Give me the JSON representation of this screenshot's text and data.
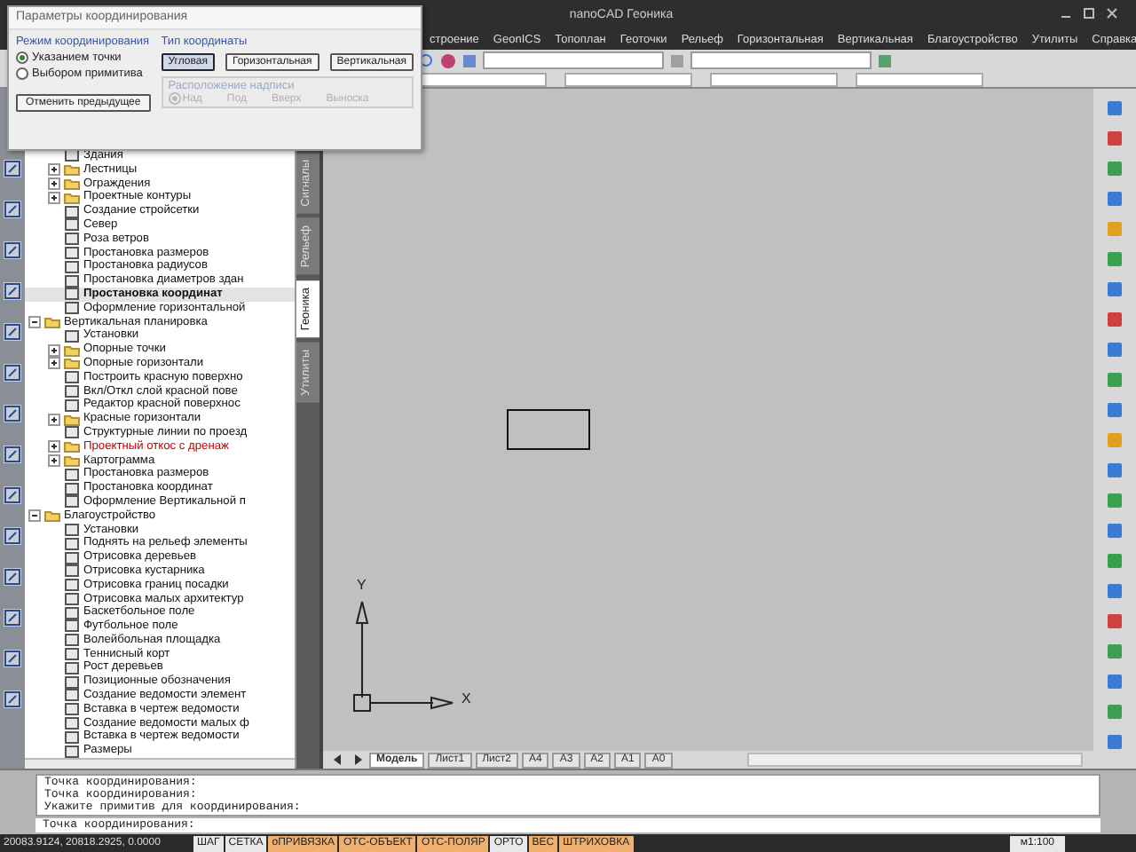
{
  "window": {
    "title": "nanoCAD Геоника"
  },
  "menu": [
    "строение",
    "GeonICS",
    "Топоплан",
    "Геоточки",
    "Рельеф",
    "Горизонтальная",
    "Вертикальная",
    "Благоустройство",
    "Утилиты",
    "Справка"
  ],
  "dialog": {
    "title": "Параметры координирования",
    "mode_group": {
      "title": "Режим координирования",
      "options": [
        {
          "label": "Указанием точки",
          "selected": true
        },
        {
          "label": "Выбором примитива",
          "selected": false
        }
      ]
    },
    "undo_button": "Отменить предыдущее",
    "type_group": {
      "title": "Тип координаты",
      "buttons": [
        {
          "label": "Угловая",
          "selected": true
        },
        {
          "label": "Горизонтальная",
          "selected": false
        },
        {
          "label": "Вертикальная",
          "selected": false
        }
      ]
    },
    "label_group": {
      "title": "Расположение надписи",
      "disabled": true,
      "options": [
        {
          "label": "Над",
          "selected": true
        },
        {
          "label": "Под",
          "selected": false
        },
        {
          "label": "Вверх",
          "selected": false
        },
        {
          "label": "Выноска",
          "selected": false
        }
      ]
    }
  },
  "tree": {
    "continued_items": [
      {
        "label": "Здания",
        "kind": "command"
      },
      {
        "label": "Лестницы",
        "kind": "folder",
        "expanded": false
      },
      {
        "label": "Ограждения",
        "kind": "folder",
        "expanded": false
      },
      {
        "label": "Проектные контуры",
        "kind": "folder",
        "expanded": false
      },
      {
        "label": "Создание стройсетки",
        "kind": "command"
      },
      {
        "label": "Север",
        "kind": "command"
      },
      {
        "label": "Роза ветров",
        "kind": "command"
      },
      {
        "label": "Простановка размеров",
        "kind": "command"
      },
      {
        "label": "Простановка радиусов",
        "kind": "command"
      },
      {
        "label": "Простановка диаметров здан",
        "kind": "command"
      },
      {
        "label": "Простановка координат",
        "kind": "command",
        "selected": true
      },
      {
        "label": "Оформление горизонтальной",
        "kind": "command"
      }
    ],
    "groups": [
      {
        "label": "Вертикальная планировка",
        "kind": "folder",
        "expanded": true,
        "children": [
          {
            "label": "Установки",
            "kind": "command"
          },
          {
            "label": "Опорные точки",
            "kind": "folder",
            "expanded": false
          },
          {
            "label": "Опорные горизонтали",
            "kind": "folder",
            "expanded": false
          },
          {
            "label": "Построить красную поверхно",
            "kind": "command"
          },
          {
            "label": "Вкл/Откл слой красной пове",
            "kind": "command"
          },
          {
            "label": "Редактор красной поверхнос",
            "kind": "command"
          },
          {
            "label": "Красные горизонтали",
            "kind": "folder",
            "expanded": false
          },
          {
            "label": "Структурные линии по проезд",
            "kind": "command"
          },
          {
            "label": "Проектный откос с дренаж",
            "kind": "folder",
            "expanded": false,
            "color": "#cc0000"
          },
          {
            "label": "Картограмма",
            "kind": "folder",
            "expanded": false
          },
          {
            "label": "Простановка размеров",
            "kind": "command"
          },
          {
            "label": "Простановка координат",
            "kind": "command"
          },
          {
            "label": "Оформление Вертикальной п",
            "kind": "command"
          }
        ]
      },
      {
        "label": "Благоустройство",
        "kind": "folder",
        "expanded": true,
        "children": [
          {
            "label": "Установки",
            "kind": "command"
          },
          {
            "label": "Поднять на рельеф элементы",
            "kind": "command"
          },
          {
            "label": "Отрисовка деревьев",
            "kind": "command"
          },
          {
            "label": "Отрисовка кустарника",
            "kind": "command"
          },
          {
            "label": "Отрисовка границ посадки",
            "kind": "command"
          },
          {
            "label": "Отрисовка малых архитектур",
            "kind": "command"
          },
          {
            "label": "Баскетбольное поле",
            "kind": "command"
          },
          {
            "label": "Футбольное поле",
            "kind": "command"
          },
          {
            "label": "Волейбольная площадка",
            "kind": "command"
          },
          {
            "label": "Теннисный корт",
            "kind": "command"
          },
          {
            "label": "Рост деревьев",
            "kind": "command"
          },
          {
            "label": "Позиционные обозначения",
            "kind": "command"
          },
          {
            "label": "Создание ведомости элемент",
            "kind": "command"
          },
          {
            "label": "Вставка в чертеж ведомости",
            "kind": "command"
          },
          {
            "label": "Создание ведомости малых ф",
            "kind": "command"
          },
          {
            "label": "Вставка в чертеж ведомости",
            "kind": "command"
          },
          {
            "label": "Размеры",
            "kind": "command"
          }
        ]
      }
    ]
  },
  "side_tabs": [
    {
      "label": "Сигналы",
      "selected": false
    },
    {
      "label": "Рельеф",
      "selected": false
    },
    {
      "label": "Геоника",
      "selected": true
    },
    {
      "label": "Утилиты",
      "selected": false
    }
  ],
  "canvas": {
    "ucs": {
      "x_label": "X",
      "y_label": "Y"
    }
  },
  "layout_tabs": [
    {
      "label": "Модель",
      "selected": true
    },
    {
      "label": "Лист1",
      "selected": false
    },
    {
      "label": "Лист2",
      "selected": false
    },
    {
      "label": "A4",
      "selected": false
    },
    {
      "label": "A3",
      "selected": false
    },
    {
      "label": "A2",
      "selected": false
    },
    {
      "label": "A1",
      "selected": false
    },
    {
      "label": "A0",
      "selected": false
    }
  ],
  "command_history": [
    "Точка координирования:",
    "Точка координирования:",
    "Укажите примитив для координирования:"
  ],
  "command_prompt": "Точка координирования:",
  "status_bar": {
    "coordinates": "20083.9124, 20818.2925, 0.0000",
    "toggles": [
      {
        "label": "ШАГ",
        "on": false
      },
      {
        "label": "СЕТКА",
        "on": false
      },
      {
        "label": "оПРИВЯЗКА",
        "on": true
      },
      {
        "label": "ОТС-ОБЪЕКТ",
        "on": true
      },
      {
        "label": "ОТС-ПОЛЯР",
        "on": true
      },
      {
        "label": "ОРТО",
        "on": false
      },
      {
        "label": "ВЕС",
        "on": true
      },
      {
        "label": "ШТРИХОВКА",
        "on": true
      }
    ],
    "scale": "м1:100"
  }
}
